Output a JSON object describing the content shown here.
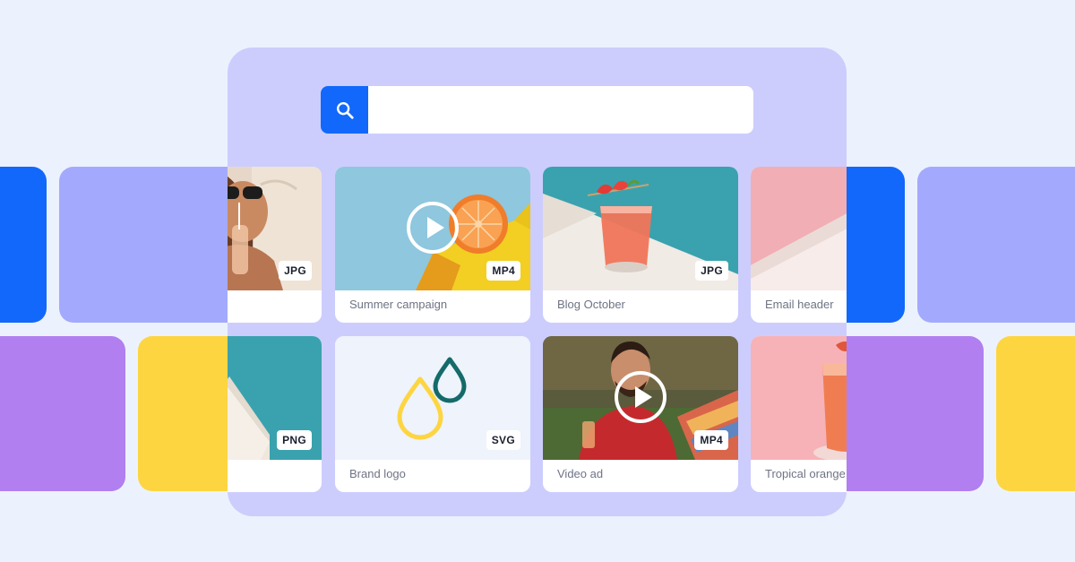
{
  "search": {
    "value": "",
    "placeholder": ""
  },
  "assets": [
    {
      "caption": "",
      "format": "JPG"
    },
    {
      "caption": "Summer campaign",
      "format": "MP4"
    },
    {
      "caption": "Blog October",
      "format": "JPG"
    },
    {
      "caption": "Email header",
      "format": ""
    },
    {
      "caption": "",
      "format": "PNG"
    },
    {
      "caption": "Brand logo",
      "format": "SVG"
    },
    {
      "caption": "Video ad",
      "format": "MP4"
    },
    {
      "caption": "Tropical orange",
      "format": ""
    }
  ],
  "colors": {
    "background": "#ecf2fd",
    "panel": "#cccdfd",
    "accent_blue": "#1268fb",
    "tile_periwinkle": "#a3aafd",
    "tile_purple": "#b17fef",
    "tile_yellow": "#fdd540"
  },
  "icons": {
    "search": "search-icon",
    "play": "play-icon"
  }
}
